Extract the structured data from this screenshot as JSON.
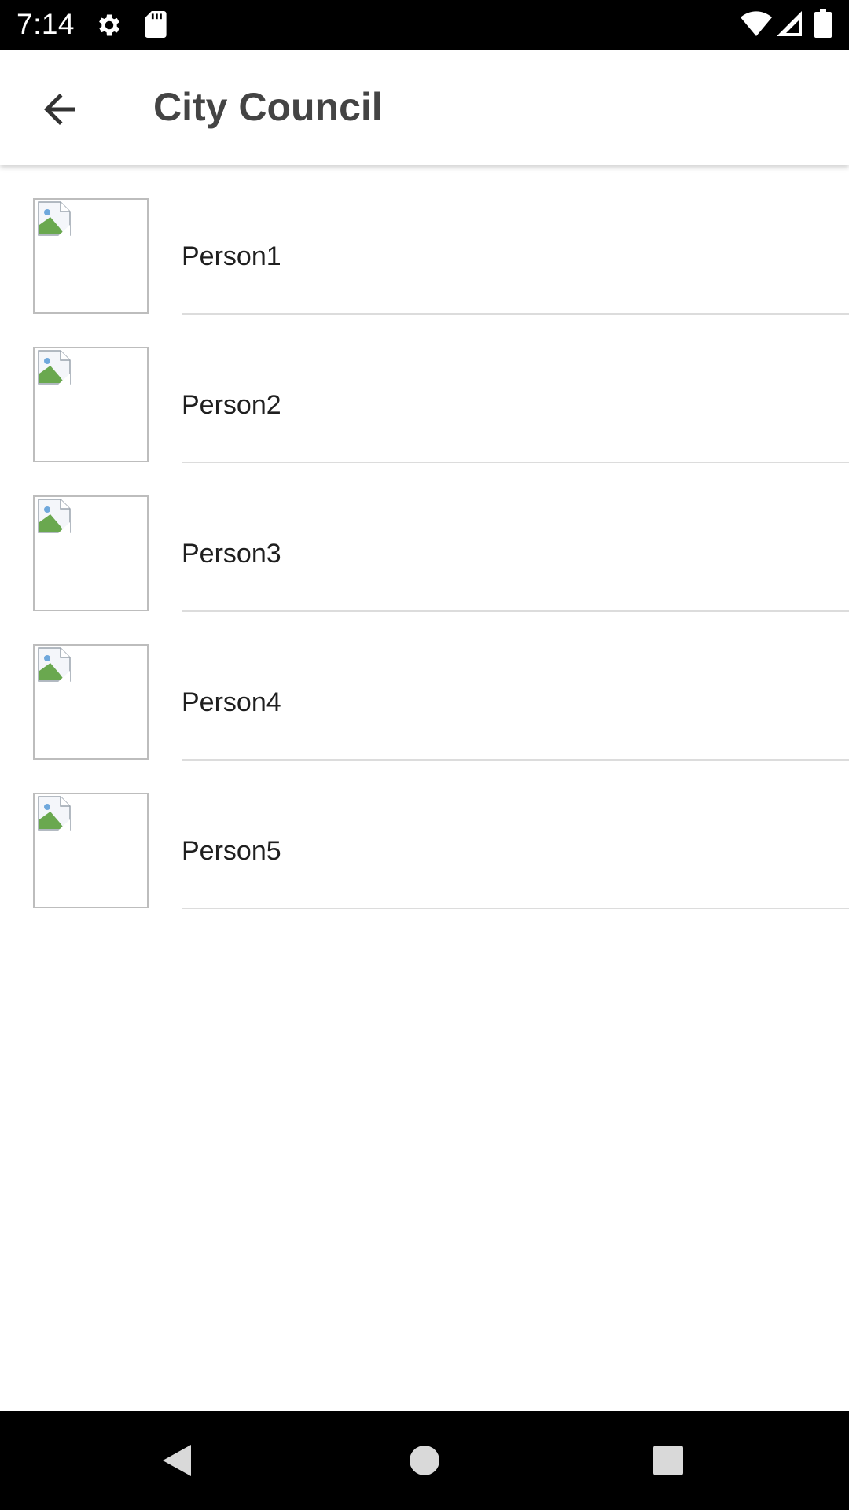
{
  "status_bar": {
    "time": "7:14",
    "icons": [
      "gear-icon",
      "sd-card-icon",
      "wifi-icon",
      "signal-icon",
      "battery-icon"
    ]
  },
  "app_bar": {
    "title": "City Council",
    "back_icon": "arrow-back-icon"
  },
  "list": {
    "items": [
      {
        "label": "Person1",
        "image": "broken-image-icon"
      },
      {
        "label": "Person2",
        "image": "broken-image-icon"
      },
      {
        "label": "Person3",
        "image": "broken-image-icon"
      },
      {
        "label": "Person4",
        "image": "broken-image-icon"
      },
      {
        "label": "Person5",
        "image": "broken-image-icon"
      }
    ]
  },
  "nav_bar": {
    "icons": [
      "nav-back-icon",
      "nav-home-icon",
      "nav-recents-icon"
    ]
  },
  "colors": {
    "status_bar": "#000000",
    "app_bar": "#ffffff",
    "title_text": "#444444",
    "divider": "#dcdcdc",
    "nav_bar": "#000000"
  }
}
